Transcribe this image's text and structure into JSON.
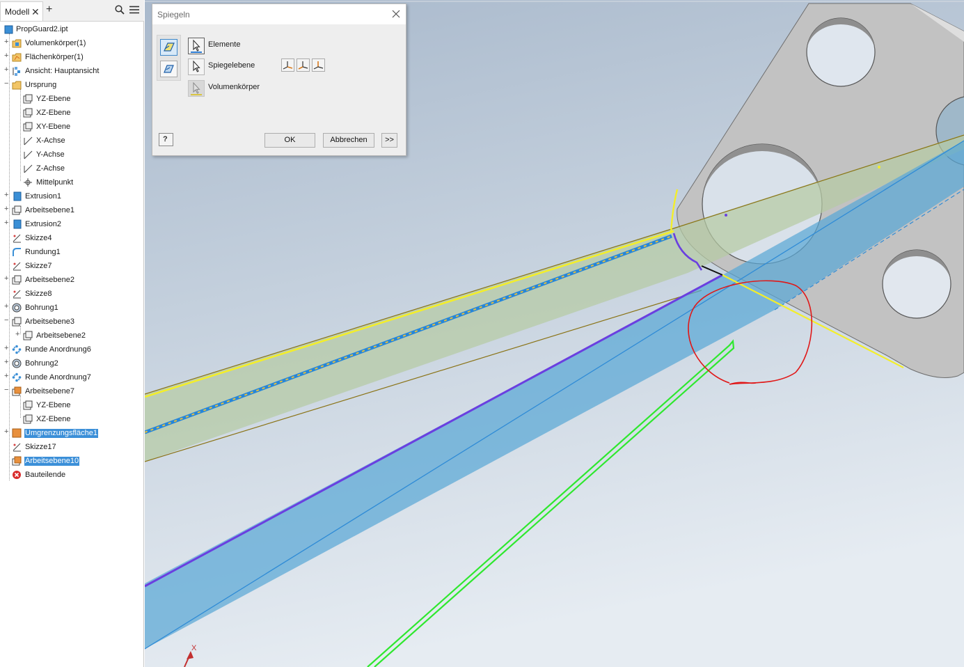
{
  "browser": {
    "tab_label": "Modell",
    "tree": [
      {
        "label": "PropGuard2.ipt",
        "level": 0,
        "expander": "",
        "icon": "part-icon",
        "selected": false
      },
      {
        "label": "Volumenkörper(1)",
        "level": 1,
        "expander": "+",
        "icon": "solid-bodies-folder-icon",
        "selected": false
      },
      {
        "label": "Flächenkörper(1)",
        "level": 1,
        "expander": "+",
        "icon": "surface-bodies-folder-icon",
        "selected": false
      },
      {
        "label": "Ansicht: Hauptansicht",
        "level": 1,
        "expander": "+",
        "icon": "view-rep-icon",
        "selected": false
      },
      {
        "label": "Ursprung",
        "level": 1,
        "expander": "−",
        "icon": "origin-folder-icon",
        "selected": false
      },
      {
        "label": "YZ-Ebene",
        "level": 2,
        "expander": "",
        "icon": "plane-icon",
        "selected": false
      },
      {
        "label": "XZ-Ebene",
        "level": 2,
        "expander": "",
        "icon": "plane-icon",
        "selected": false
      },
      {
        "label": "XY-Ebene",
        "level": 2,
        "expander": "",
        "icon": "plane-icon",
        "selected": false
      },
      {
        "label": "X-Achse",
        "level": 2,
        "expander": "",
        "icon": "axis-icon",
        "selected": false
      },
      {
        "label": "Y-Achse",
        "level": 2,
        "expander": "",
        "icon": "axis-icon",
        "selected": false
      },
      {
        "label": "Z-Achse",
        "level": 2,
        "expander": "",
        "icon": "axis-icon",
        "selected": false
      },
      {
        "label": "Mittelpunkt",
        "level": 2,
        "expander": "",
        "icon": "center-point-icon",
        "selected": false
      },
      {
        "label": "Extrusion1",
        "level": 1,
        "expander": "+",
        "icon": "extrusion-icon",
        "selected": false
      },
      {
        "label": "Arbeitsebene1",
        "level": 1,
        "expander": "+",
        "icon": "workplane-icon",
        "selected": false
      },
      {
        "label": "Extrusion2",
        "level": 1,
        "expander": "+",
        "icon": "extrusion-icon",
        "selected": false
      },
      {
        "label": "Skizze4",
        "level": 1,
        "expander": "",
        "icon": "sketch-icon",
        "selected": false
      },
      {
        "label": "Rundung1",
        "level": 1,
        "expander": "",
        "icon": "fillet-icon",
        "selected": false
      },
      {
        "label": "Skizze7",
        "level": 1,
        "expander": "",
        "icon": "sketch-icon",
        "selected": false
      },
      {
        "label": "Arbeitsebene2",
        "level": 1,
        "expander": "+",
        "icon": "workplane-icon",
        "selected": false
      },
      {
        "label": "Skizze8",
        "level": 1,
        "expander": "",
        "icon": "sketch-icon",
        "selected": false
      },
      {
        "label": "Bohrung1",
        "level": 1,
        "expander": "+",
        "icon": "hole-icon",
        "selected": false
      },
      {
        "label": "Arbeitsebene3",
        "level": 1,
        "expander": "−",
        "icon": "workplane-icon",
        "selected": false
      },
      {
        "label": "Arbeitsebene2",
        "level": 2,
        "expander": "+",
        "icon": "workplane-icon",
        "selected": false
      },
      {
        "label": "Runde Anordnung6",
        "level": 1,
        "expander": "+",
        "icon": "circular-pattern-icon",
        "selected": false
      },
      {
        "label": "Bohrung2",
        "level": 1,
        "expander": "+",
        "icon": "hole-icon",
        "selected": false
      },
      {
        "label": "Runde Anordnung7",
        "level": 1,
        "expander": "+",
        "icon": "circular-pattern-icon",
        "selected": false
      },
      {
        "label": "Arbeitsebene7",
        "level": 1,
        "expander": "−",
        "icon": "workplane-orange-icon",
        "selected": false
      },
      {
        "label": "YZ-Ebene",
        "level": 2,
        "expander": "",
        "icon": "plane-icon",
        "selected": false
      },
      {
        "label": "XZ-Ebene",
        "level": 2,
        "expander": "",
        "icon": "plane-icon",
        "selected": false
      },
      {
        "label": "Umgrenzungsfläche1",
        "level": 1,
        "expander": "+",
        "icon": "boundary-patch-icon",
        "selected": true
      },
      {
        "label": "Skizze17",
        "level": 1,
        "expander": "",
        "icon": "sketch-icon",
        "selected": false
      },
      {
        "label": "Arbeitsebene10",
        "level": 1,
        "expander": "",
        "icon": "workplane-orange-icon",
        "selected": true
      },
      {
        "label": "Bauteilende",
        "level": 1,
        "expander": "",
        "icon": "end-of-part-icon",
        "selected": false
      }
    ]
  },
  "dialog": {
    "title": "Spiegeln",
    "elements_label": "Elemente",
    "mirror_plane_label": "Spiegelebene",
    "solids_label": "Volumenkörper",
    "ok_label": "OK",
    "cancel_label": "Abbrechen",
    "more_label": ">>",
    "help_label": "?"
  },
  "viewport": {
    "triad_x_label": "X"
  },
  "colors": {
    "selection_blue": "#3b8fd8",
    "plane_blue": "#6ab0d8",
    "plane_green": "#b4cca0",
    "edge_yellow": "#f2ef2a",
    "edge_purple": "#6a3fe0",
    "sketch_green": "#2ee82e",
    "markup_red": "#e01818",
    "part_grey": "#c6c6c6"
  }
}
